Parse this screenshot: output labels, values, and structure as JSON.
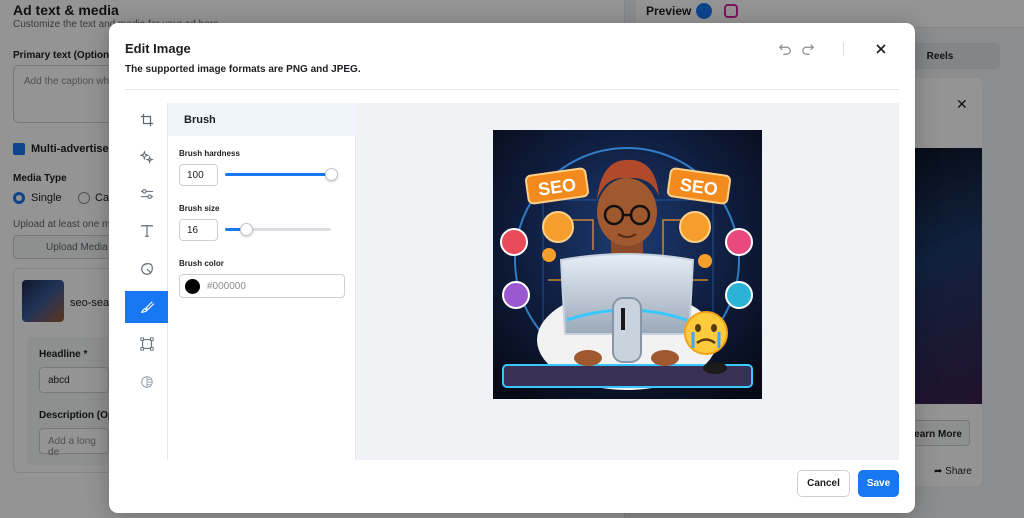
{
  "background": {
    "section_title": "Ad text & media",
    "section_subtitle": "Customize the text and media for your ad here",
    "primary_text_label": "Primary text (Optional)",
    "primary_text_placeholder": "Add the caption wh",
    "multi_advertiser_label": "Multi-advertiser a",
    "media_type_label": "Media Type",
    "media_single": "Single",
    "media_carousel": "Ca",
    "upload_hint": "Upload at least one m",
    "upload_button": "Upload Media",
    "file_name": "seo-sea",
    "headline_label": "Headline *",
    "headline_value": "abcd",
    "description_label": "Description (Opti",
    "description_placeholder": "Add a long de",
    "preview_label": "Preview",
    "reels_tab": "Reels",
    "learn_more": "Learn More",
    "share": "Share"
  },
  "modal": {
    "title": "Edit Image",
    "subtitle": "The supported image formats are PNG and JPEG.",
    "panel_title": "Brush",
    "brush_hardness_label": "Brush hardness",
    "brush_hardness_value": "100",
    "brush_hardness_level": 1.0,
    "brush_size_label": "Brush size",
    "brush_size_value": "16",
    "brush_size_level": 0.2,
    "brush_color_label": "Brush color",
    "brush_color_placeholder": "#000000",
    "brush_color": "#000000",
    "cancel_label": "Cancel",
    "save_label": "Save",
    "accent_color": "#1877f2",
    "image_labels": [
      "SEO",
      "SEO"
    ],
    "tools": [
      "crop-icon",
      "magic-sparkle-icon",
      "adjust-sliders-icon",
      "text-icon",
      "sticker-icon",
      "brush-icon",
      "frame-icon",
      "filter-icon"
    ],
    "active_tool": "brush-icon"
  }
}
